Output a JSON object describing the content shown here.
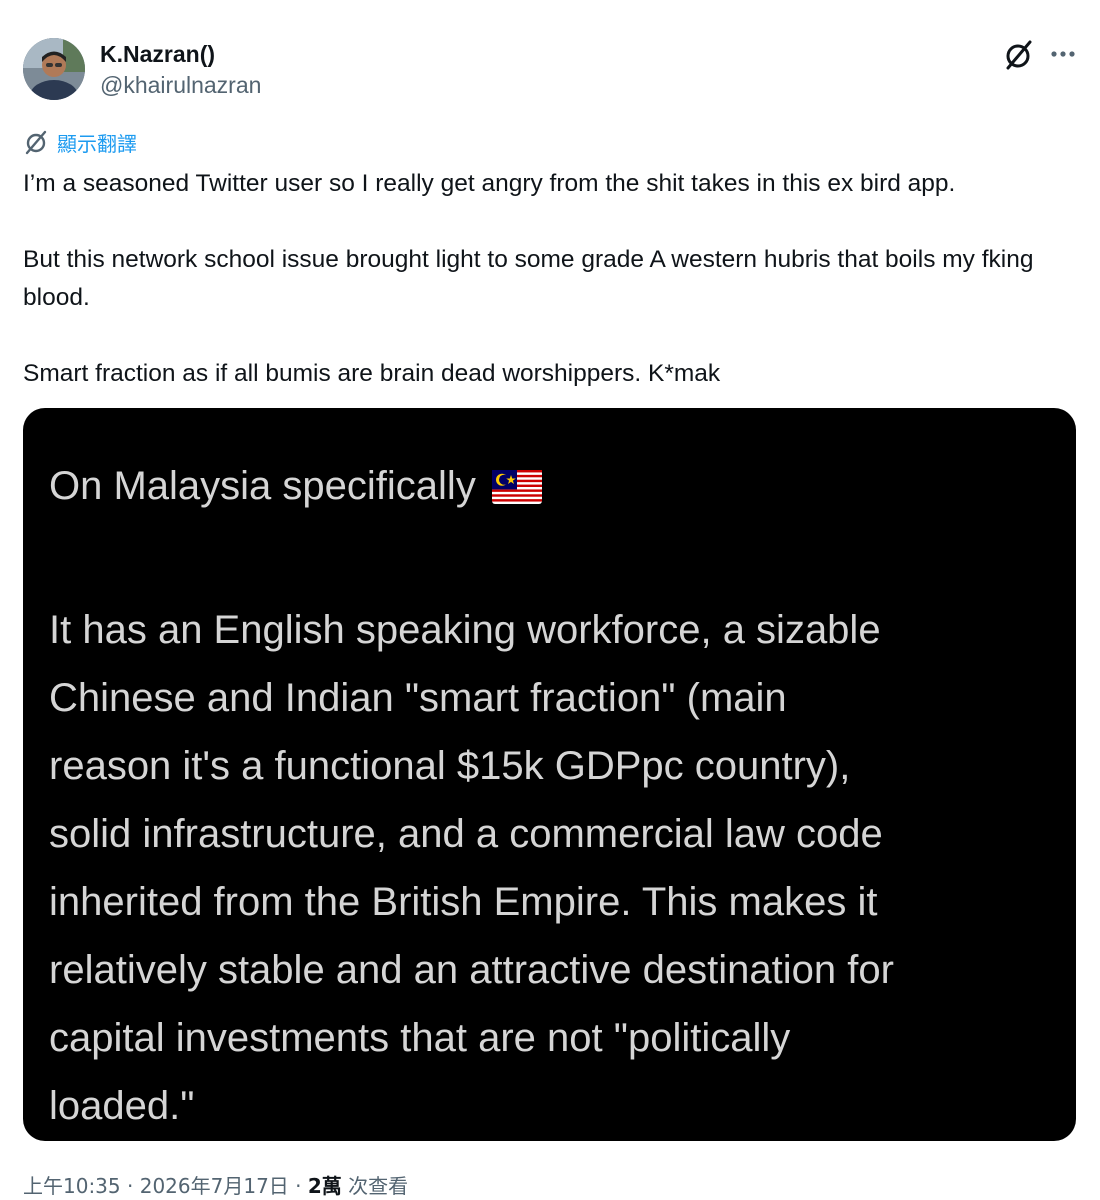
{
  "author": {
    "display_name": "K.Nazran()",
    "handle": "@khairulnazran"
  },
  "header": {
    "grok_icon": "grok-slash-circle-icon",
    "more_icon": "more-horizontal-icon"
  },
  "translate": {
    "label": "顯示翻譯",
    "icon": "translate-slash-icon"
  },
  "tweet_text": {
    "paragraph_1": "I’m a seasoned Twitter user so I really get angry from the shit takes in this ex bird app.",
    "paragraph_2": "But this network school issue brought light to some grade A western hubris that boils my fking blood.",
    "paragraph_3": "Smart fraction as if all bumis are brain dead worshippers. K*mak"
  },
  "media": {
    "heading": "On Malaysia specifically",
    "flag_icon": "malaysia-flag-icon",
    "lines": [
      "It has an English speaking workforce, a sizable",
      "Chinese and Indian \"smart fraction\" (main",
      "reason it's a functional $15k GDPpc country),",
      "solid infrastructure, and a commercial law code",
      "inherited from the British Empire. This makes it",
      "relatively stable and an attractive destination for",
      "capital investments that are not \"politically",
      "loaded.\""
    ]
  },
  "footer": {
    "time": "上午10:35",
    "separator_1": " · ",
    "date": "2026年7月17日",
    "separator_2": " · ",
    "views_count": "2萬",
    "views_label": " 次查看"
  },
  "colors": {
    "link_blue": "#1d9bf0",
    "secondary_text": "#536471",
    "primary_text": "#0f1419",
    "media_background": "#000000",
    "media_text": "#d5d5d5"
  }
}
